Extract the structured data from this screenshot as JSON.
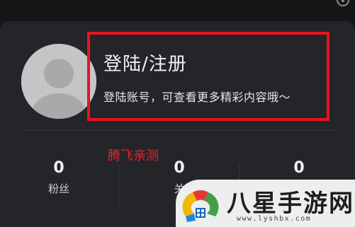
{
  "profile": {
    "login_title": "登陆/注册",
    "login_subtitle": "登陆账号，可查看更多精彩内容哦～",
    "avatar_icon": "default-user-avatar"
  },
  "watermark": {
    "text": "腾飞亲测"
  },
  "stats": [
    {
      "value": "0",
      "label": "粉丝"
    },
    {
      "value": "0",
      "label": "关"
    },
    {
      "value": "0",
      "label": ""
    }
  ],
  "logo": {
    "text": "八星手游网",
    "url": "www.lyshbx.com"
  },
  "colors": {
    "highlight_border": "#e8141f",
    "card_background": "#242528",
    "watermark": "#e0262e"
  }
}
